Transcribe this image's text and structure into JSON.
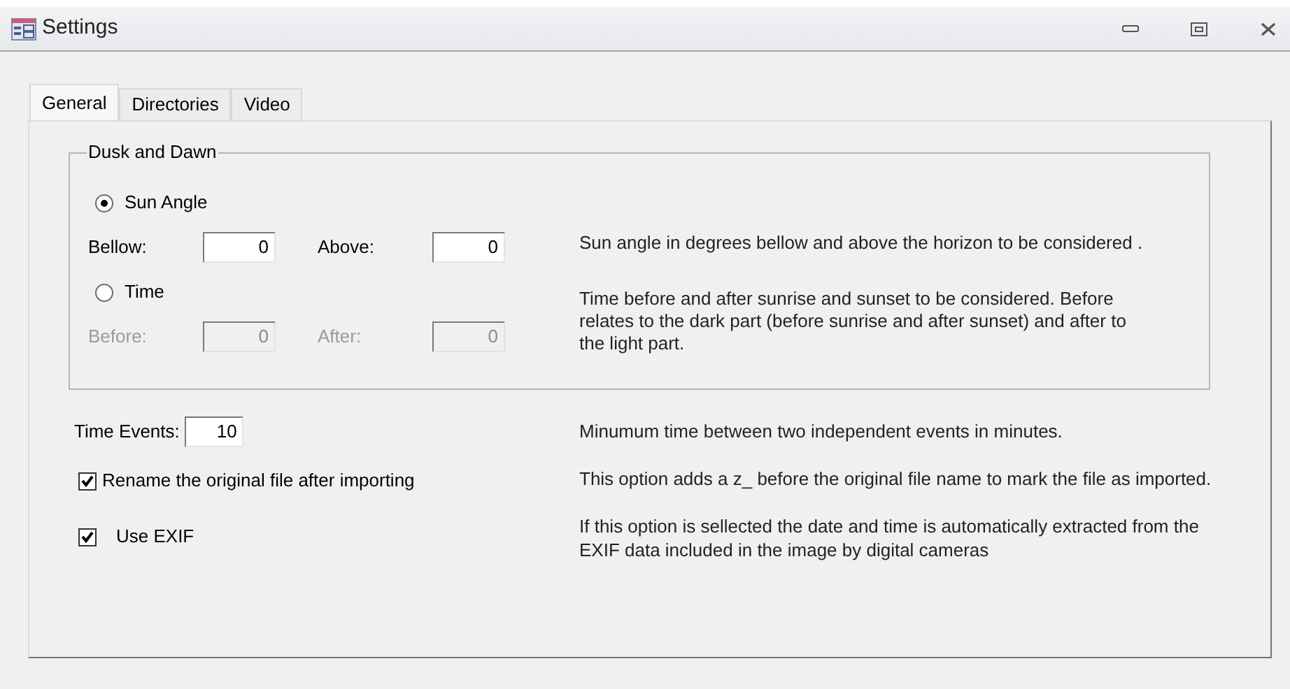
{
  "window": {
    "title": "Settings"
  },
  "tabs": [
    {
      "label": "General",
      "selected": true
    },
    {
      "label": "Directories",
      "selected": false
    },
    {
      "label": "Video",
      "selected": false
    }
  ],
  "dusk_and_dawn": {
    "title": "Dusk and Dawn",
    "modes": [
      {
        "label": "Sun Angle",
        "selected": true,
        "fields": [
          {
            "label": "Bellow:",
            "value": "0"
          },
          {
            "label": "Above:",
            "value": "0"
          }
        ],
        "description": "Sun angle in degrees bellow and above the horizon to be considered ."
      },
      {
        "label": "Time",
        "selected": false,
        "fields": [
          {
            "label": "Before:",
            "value": "0"
          },
          {
            "label": "After:",
            "value": "0"
          }
        ],
        "description": "Time before and after sunrise and sunset to be considered. Before relates to the dark part (before sunrise and after sunset) and after to the light part."
      }
    ]
  },
  "time_events": {
    "label": "Time Events:",
    "value": "10",
    "description": "Minumum time between two independent events in minutes."
  },
  "options": [
    {
      "label": "Rename the original file after importing",
      "checked": true,
      "description": "This option adds a z_ before the original file name to mark the file as imported."
    },
    {
      "label": "Use EXIF",
      "checked": true,
      "description": "If this option is sellected the date and time is automatically extracted from the EXIF data included in the image by digital cameras"
    }
  ]
}
